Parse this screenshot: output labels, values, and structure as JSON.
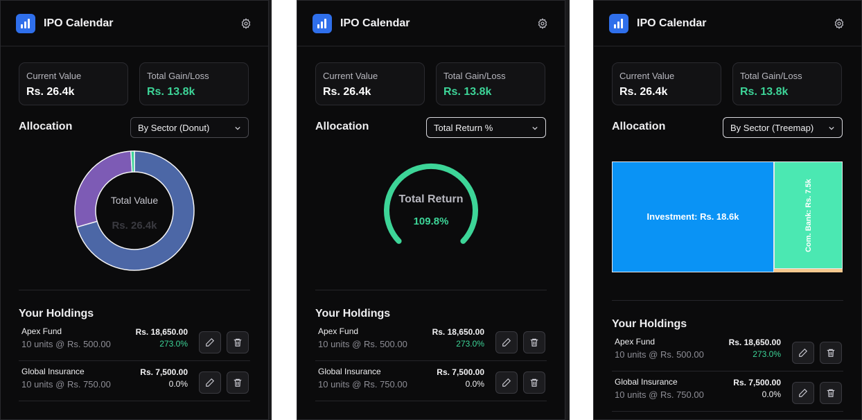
{
  "header": {
    "title": "IPO Calendar"
  },
  "summary": {
    "current_value_label": "Current Value",
    "current_value": "Rs. 26.4k",
    "gain_label": "Total Gain/Loss",
    "gain_value": "Rs. 13.8k"
  },
  "allocation": {
    "label": "Allocation",
    "views": [
      {
        "selected": "By Sector (Donut)"
      },
      {
        "selected": "Total Return %"
      },
      {
        "selected": "By Sector (Treemap)"
      }
    ],
    "donut": {
      "center_label": "Total Value",
      "center_value": "Rs. 26.4k",
      "segments": [
        {
          "value": 18.6,
          "color": "#4c67a6"
        },
        {
          "value": 7.5,
          "color": "#7d5bb5"
        },
        {
          "value": 0.25,
          "color": "#3dd598"
        }
      ]
    },
    "gauge": {
      "label": "Total Return",
      "value_text": "109.8%",
      "color": "#3dd598"
    },
    "treemap": [
      {
        "label": "Investment: Rs. 18.6k",
        "color": "#0a93f5"
      },
      {
        "label": "Com. Bank: Rs. 7.5k",
        "color": "#4be8b2"
      }
    ]
  },
  "holdings": {
    "title": "Your Holdings",
    "items": [
      {
        "name": "Apex Fund",
        "detail": "10 units @ Rs. 500.00",
        "amount": "Rs. 18,650.00",
        "pct": "273.0%"
      },
      {
        "name": "Global Insurance",
        "detail": "10 units @ Rs. 750.00",
        "amount": "Rs. 7,500.00",
        "pct": "0.0%"
      }
    ]
  },
  "icons": [
    "bar-chart-icon",
    "gear-icon",
    "chevron-down-icon",
    "pencil-icon",
    "trash-icon"
  ]
}
